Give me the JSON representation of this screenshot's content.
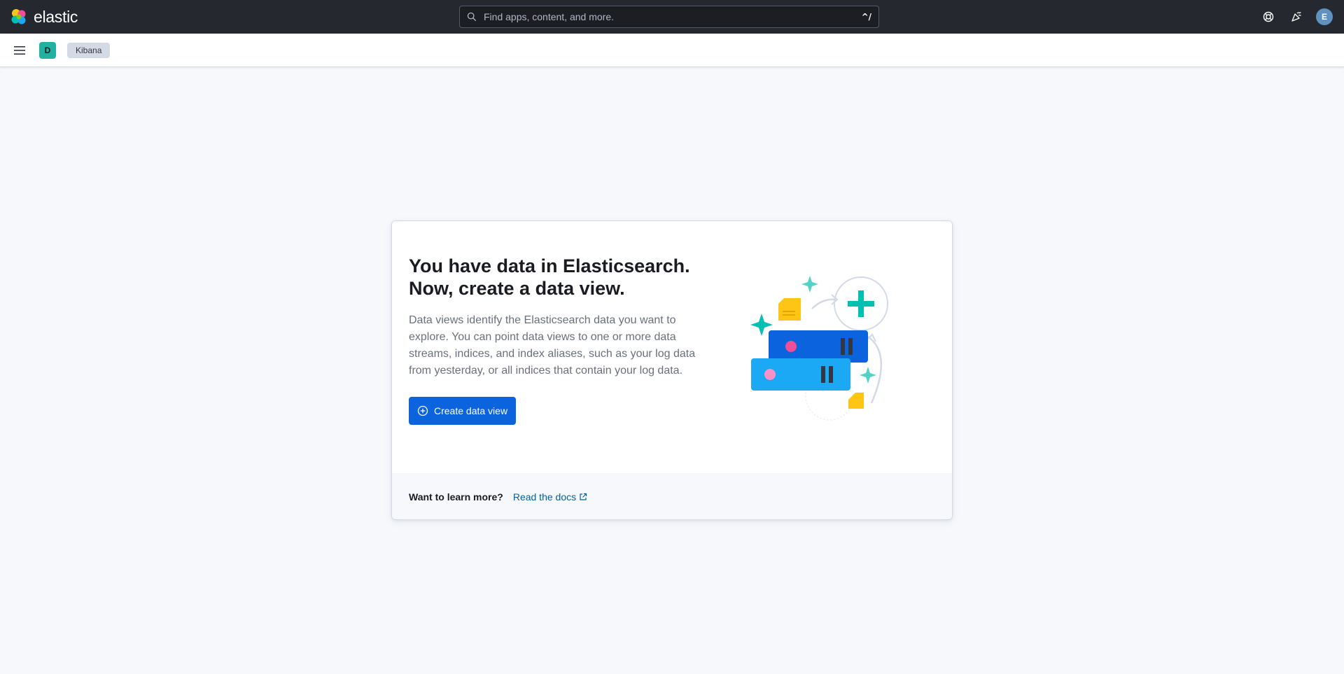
{
  "header": {
    "logo_text": "elastic",
    "search_placeholder": "Find apps, content, and more.",
    "search_shortcut": "^/",
    "user_initial": "E"
  },
  "subheader": {
    "space_initial": "D",
    "breadcrumb": "Kibana"
  },
  "card": {
    "title_line1": "You have data in Elasticsearch.",
    "title_line2": "Now, create a data view.",
    "description": "Data views identify the Elasticsearch data you want to explore. You can point data views to one or more data streams, indices, and index aliases, such as your log data from yesterday, or all indices that contain your log data.",
    "button_label": "Create data view",
    "footer_label": "Want to learn more?",
    "docs_link": "Read the docs"
  },
  "icons": [
    "search-icon",
    "help-icon",
    "newsfeed-icon",
    "menu-icon",
    "plus-circle-icon",
    "external-link-icon"
  ],
  "colors": {
    "header_bg": "#25282f",
    "primary": "#0b64dd",
    "link": "#0061a6",
    "space_avatar": "#20b1a1",
    "user_avatar": "#6092c0"
  }
}
